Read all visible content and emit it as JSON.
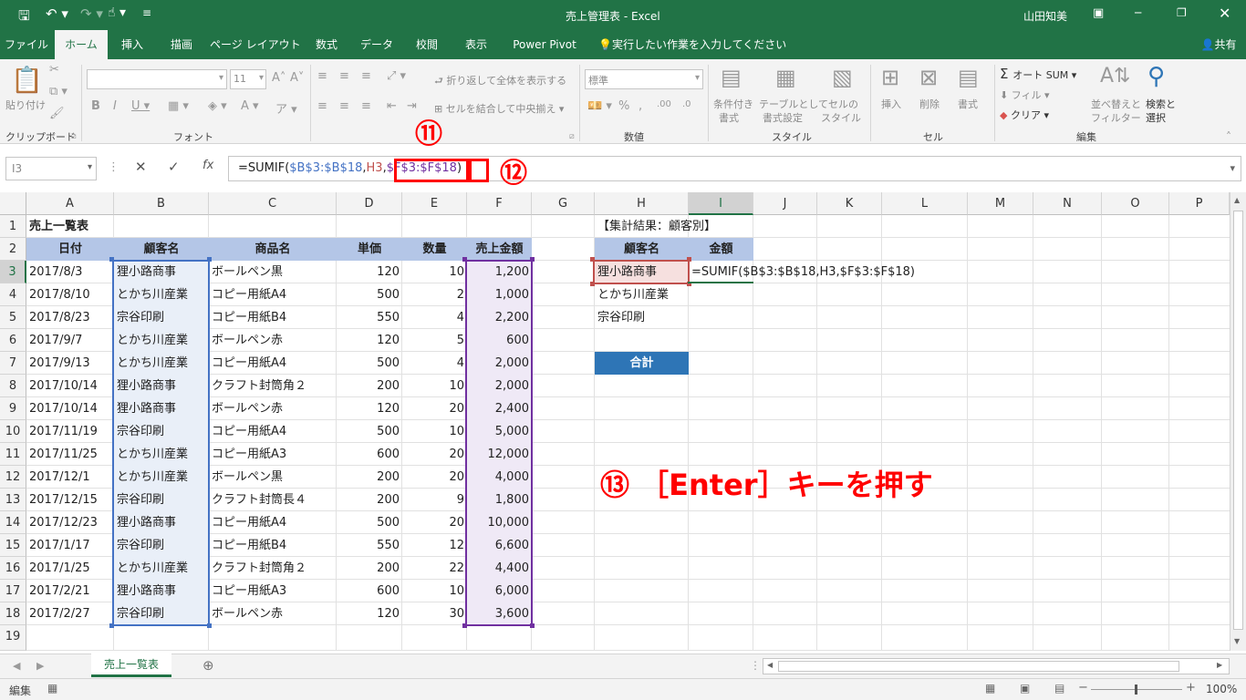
{
  "window": {
    "title": "売上管理表 - Excel",
    "user": "山田知美",
    "share": "共有"
  },
  "tabs": [
    "ファイル",
    "ホーム",
    "挿入",
    "描画",
    "ページ レイアウト",
    "数式",
    "データ",
    "校閲",
    "表示",
    "Power Pivot",
    "実行したい作業を入力してください"
  ],
  "ribbon": {
    "paste": "貼り付け",
    "clipboard": "クリップボード",
    "font_size": "11",
    "font_group": "フォント",
    "wrap_text": "折り返して全体を表示する",
    "merge_center": "セルを結合して中央揃え",
    "number_format": "標準",
    "number_group": "数値",
    "cond_format_1": "条件付き",
    "cond_format_2": "書式",
    "table_format_1": "テーブルとして",
    "table_format_2": "書式設定",
    "cell_style_1": "セルの",
    "cell_style_2": "スタイル",
    "style_group": "スタイル",
    "insert": "挿入",
    "delete": "削除",
    "format": "書式",
    "cells_group": "セル",
    "autosum": "オート SUM",
    "fill": "フィル",
    "clear": "クリア",
    "sort_1": "並べ替えと",
    "sort_2": "フィルター",
    "find_1": "検索と",
    "find_2": "選択",
    "edit_group": "編集"
  },
  "formula_bar": {
    "name_box": "I3",
    "prefix": "=SUMIF(",
    "arg1": "$B$3:$B$18",
    "comma1": ",",
    "arg2": "H3",
    "comma2": ",",
    "arg3": "$F$3:$F$18",
    "suffix": ")"
  },
  "annotations": {
    "step11": "⑪",
    "step12": "⑫",
    "step13": "⑬ ［Enter］キーを押す"
  },
  "colors": {
    "excel_green": "#217346",
    "header_blue": "#b4c6e7",
    "total_blue": "#2e75b6",
    "callout_red": "#ff0000",
    "ref_blue": "#4472c4",
    "ref_purple": "#7030a0",
    "ref_red": "#c0504d"
  },
  "columns": [
    "A",
    "B",
    "C",
    "D",
    "E",
    "F",
    "G",
    "H",
    "I",
    "J",
    "K",
    "L",
    "M",
    "N",
    "O",
    "P"
  ],
  "rows": [
    "1",
    "2",
    "3",
    "4",
    "5",
    "6",
    "7",
    "8",
    "9",
    "10",
    "11",
    "12",
    "13",
    "14",
    "15",
    "16",
    "17",
    "18",
    "19"
  ],
  "sheet": {
    "title": "売上一覧表",
    "headers": [
      "日付",
      "顧客名",
      "商品名",
      "単価",
      "数量",
      "売上金額"
    ],
    "data": [
      [
        "2017/8/3",
        "狸小路商事",
        "ボールペン黒",
        "120",
        "10",
        "1,200"
      ],
      [
        "2017/8/10",
        "とかち川産業",
        "コピー用紙A4",
        "500",
        "2",
        "1,000"
      ],
      [
        "2017/8/23",
        "宗谷印刷",
        "コピー用紙B4",
        "550",
        "4",
        "2,200"
      ],
      [
        "2017/9/7",
        "とかち川産業",
        "ボールペン赤",
        "120",
        "5",
        "600"
      ],
      [
        "2017/9/13",
        "とかち川産業",
        "コピー用紙A4",
        "500",
        "4",
        "2,000"
      ],
      [
        "2017/10/14",
        "狸小路商事",
        "クラフト封筒角２",
        "200",
        "10",
        "2,000"
      ],
      [
        "2017/10/14",
        "狸小路商事",
        "ボールペン赤",
        "120",
        "20",
        "2,400"
      ],
      [
        "2017/11/19",
        "宗谷印刷",
        "コピー用紙A4",
        "500",
        "10",
        "5,000"
      ],
      [
        "2017/11/25",
        "とかち川産業",
        "コピー用紙A3",
        "600",
        "20",
        "12,000"
      ],
      [
        "2017/12/1",
        "とかち川産業",
        "ボールペン黒",
        "200",
        "20",
        "4,000"
      ],
      [
        "2017/12/15",
        "宗谷印刷",
        "クラフト封筒長４",
        "200",
        "9",
        "1,800"
      ],
      [
        "2017/12/23",
        "狸小路商事",
        "コピー用紙A4",
        "500",
        "20",
        "10,000"
      ],
      [
        "2017/1/17",
        "宗谷印刷",
        "コピー用紙B4",
        "550",
        "12",
        "6,600"
      ],
      [
        "2017/1/25",
        "とかち川産業",
        "クラフト封筒角２",
        "200",
        "22",
        "4,400"
      ],
      [
        "2017/2/21",
        "狸小路商事",
        "コピー用紙A3",
        "600",
        "10",
        "6,000"
      ],
      [
        "2017/2/27",
        "宗谷印刷",
        "ボールペン赤",
        "120",
        "30",
        "3,600"
      ]
    ],
    "summary_title": "【集計結果：顧客別】",
    "summary_headers": [
      "顧客名",
      "金額"
    ],
    "summary_rows": [
      "狸小路商事",
      "とかち川産業",
      "宗谷印刷"
    ],
    "total_label": "合計",
    "cell_edit": "=SUMIF($B$3:$B$18,H3,$F$3:$F$18)"
  },
  "sheet_tab": "売上一覧表",
  "status": {
    "mode": "編集",
    "zoom": "100%"
  }
}
